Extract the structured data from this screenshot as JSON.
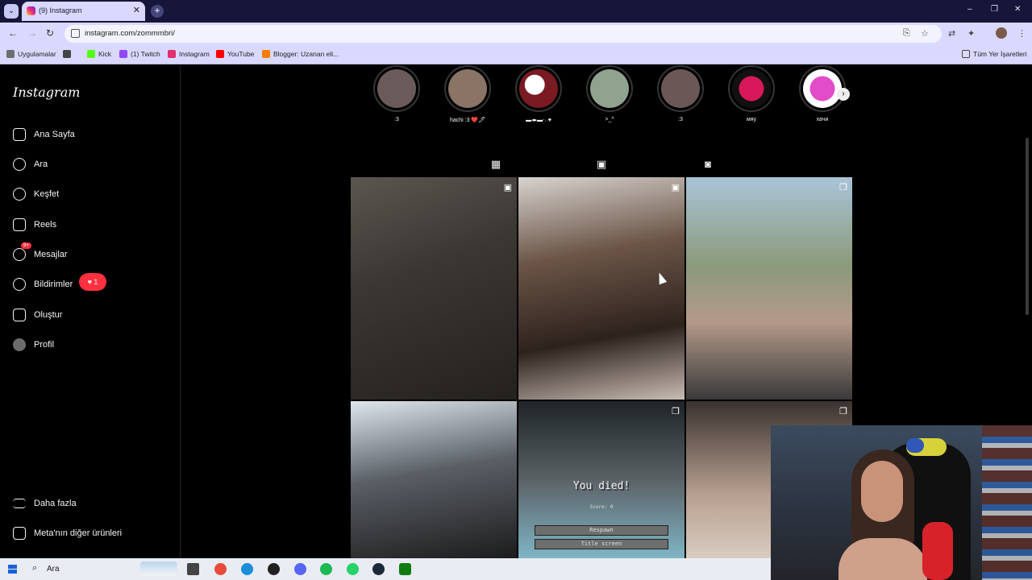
{
  "browser": {
    "tab_title": "(9) Instagram",
    "tab_close": "✕",
    "new_tab": "+",
    "url": "instagram.com/zommmbri/",
    "window_controls": [
      "–",
      "❐",
      "✕"
    ],
    "bookmarks": [
      {
        "label": "Uygulamalar",
        "color": "#6d6d6d"
      },
      {
        "label": "",
        "color": "#444444"
      },
      {
        "label": "Kick",
        "color": "#53fc18"
      },
      {
        "label": "(1) Twitch",
        "color": "#9146ff"
      },
      {
        "label": "Instagram",
        "color": "#e1306c"
      },
      {
        "label": "YouTube",
        "color": "#ff0000"
      },
      {
        "label": "Blogger: Uzanan eli...",
        "color": "#f57d00"
      }
    ],
    "all_bookmarks": "Tüm Yer İşaretleri"
  },
  "sidebar": {
    "logo": "Instagram",
    "items": [
      {
        "label": "Ana Sayfa",
        "icon": "home-icon"
      },
      {
        "label": "Ara",
        "icon": "search-icon"
      },
      {
        "label": "Keşfet",
        "icon": "compass-icon"
      },
      {
        "label": "Reels",
        "icon": "reels-icon"
      },
      {
        "label": "Mesajlar",
        "icon": "messenger-icon",
        "badge": "9+"
      },
      {
        "label": "Bildirimler",
        "icon": "heart-icon",
        "notif": "1"
      },
      {
        "label": "Oluştur",
        "icon": "plus-icon"
      },
      {
        "label": "Profil",
        "icon": "avatar"
      }
    ],
    "more": "Daha fazla",
    "meta": "Meta'nın diğer ürünleri",
    "notif_heart": "♥"
  },
  "highlights": [
    {
      "label": ":3",
      "color": "#6a5a5a"
    },
    {
      "label": "hachi :3 ❤️🖋",
      "color": "#8a7466"
    },
    {
      "label": "▬◂▸▬-.·♥",
      "color": "#7a1a22"
    },
    {
      "label": ">_^",
      "color": "#8fa38f"
    },
    {
      "label": ":3",
      "color": "#6b5856"
    },
    {
      "label": "мяу",
      "color": "#d8185a"
    },
    {
      "label": "хачи",
      "color": "#e24cc9"
    }
  ],
  "profile_tabs": [
    "posts-grid-icon",
    "reels-tab-icon",
    "tagged-tab-icon"
  ],
  "posts": [
    {
      "type": "reel",
      "bg": "linear-gradient(160deg,#5c5650 0%,#3b3733 40%,#24211e 100%)"
    },
    {
      "type": "reel",
      "bg": "linear-gradient(170deg,#d8d3cf 0%,#6b5547 35%,#2e221d 70%,#c9bcb4 100%)"
    },
    {
      "type": "carousel",
      "bg": "linear-gradient(180deg,#a9c4d8 0%,#8b9a7a 40%,#b49a8a 65%,#3a3a3a 100%)"
    },
    {
      "type": "none",
      "bg": "linear-gradient(170deg,#dfe7ee 0%,#5a5f66 45%,#1c1c1c 100%)"
    },
    {
      "type": "carousel",
      "bg": "linear-gradient(180deg,#1d2326 0%,#5b6266 50%,#7fb5c5 100%)"
    },
    {
      "type": "carousel",
      "bg": "linear-gradient(180deg,#3a3230 0%,#b8a090 60%,#d8ccc0 100%)"
    }
  ],
  "game_over": {
    "title": "You died!",
    "score": "Score: 0",
    "respawn": "Respawn",
    "title_screen": "Title screen"
  },
  "taskbar": {
    "search": "Ara",
    "apps": [
      {
        "name": "task-view-icon",
        "color": "#444444"
      },
      {
        "name": "chrome-icon",
        "color": "#e84a3c"
      },
      {
        "name": "edge-icon",
        "color": "#1a8fd9"
      },
      {
        "name": "obs-icon",
        "color": "#202020"
      },
      {
        "name": "discord-icon",
        "color": "#5865f2"
      },
      {
        "name": "spotify-icon",
        "color": "#1db954"
      },
      {
        "name": "whatsapp-icon",
        "color": "#25d366"
      },
      {
        "name": "steam-icon",
        "color": "#1b2838"
      },
      {
        "name": "xbox-icon",
        "color": "#107c10"
      }
    ]
  }
}
